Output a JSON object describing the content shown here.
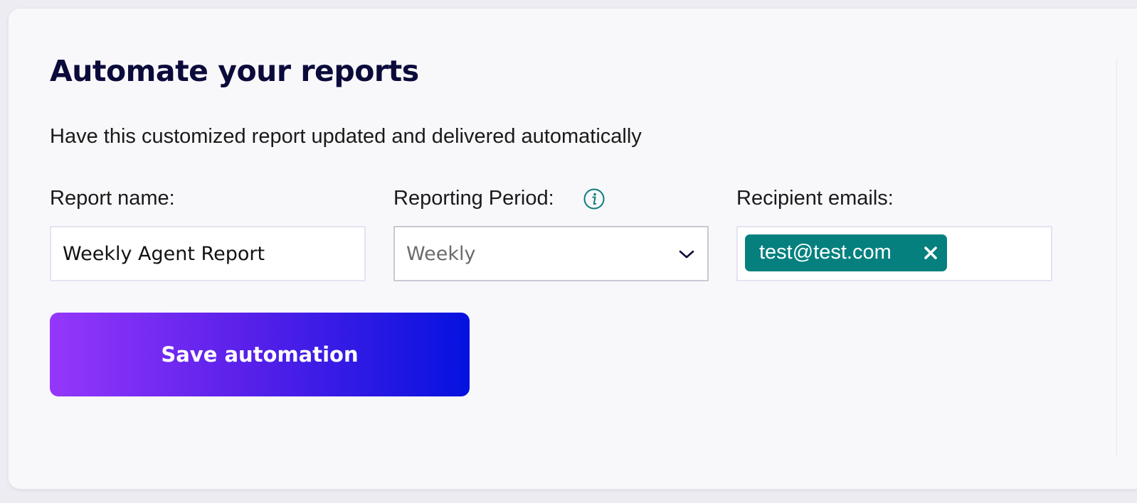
{
  "header": {
    "title": "Automate your reports",
    "subtitle": "Have this customized report updated and delivered automatically"
  },
  "form": {
    "report_name": {
      "label": "Report name:",
      "value": "Weekly Agent Report"
    },
    "reporting_period": {
      "label": "Reporting Period:",
      "selected": "Weekly",
      "info_icon": "info-icon"
    },
    "recipients": {
      "label": "Recipient emails:",
      "emails": [
        "test@test.com"
      ],
      "remove_icon": "close-icon"
    }
  },
  "actions": {
    "save_label": "Save automation"
  },
  "colors": {
    "title": "#0b0b3b",
    "chip": "#05807f",
    "button_gradient_start": "#9537fb",
    "button_gradient_end": "#0512df"
  }
}
